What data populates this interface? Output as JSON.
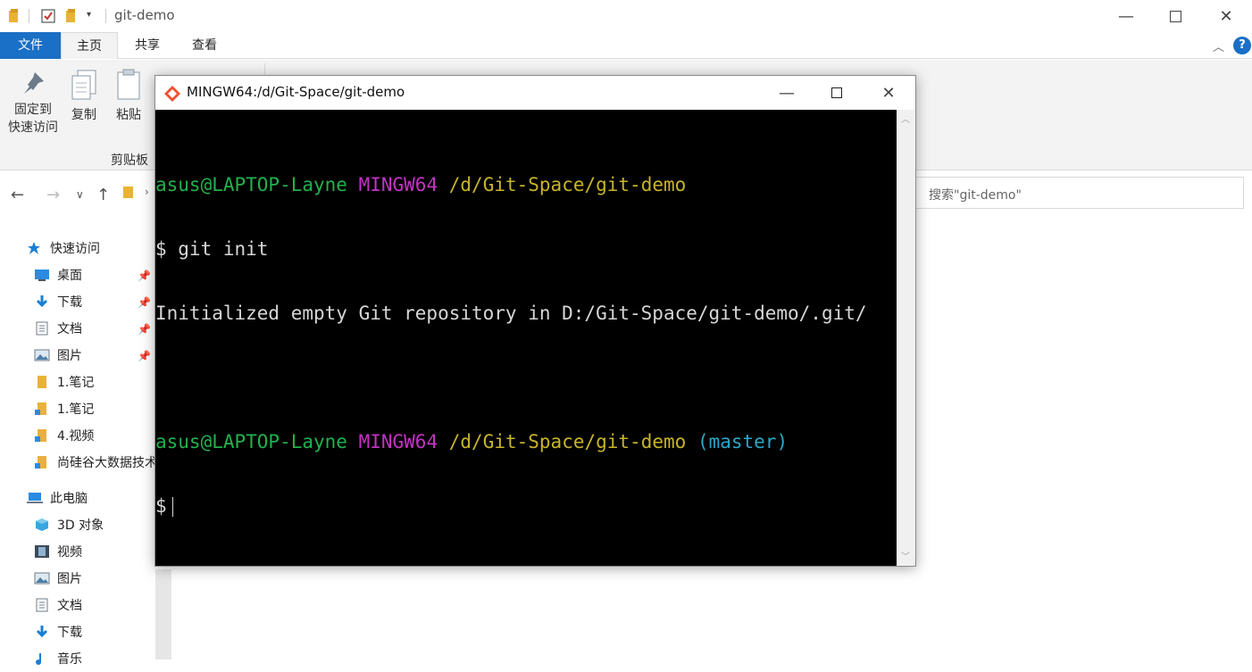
{
  "explorer": {
    "window_title": "git-demo",
    "tabs": [
      {
        "label": "文件"
      },
      {
        "label": "主页"
      },
      {
        "label": "共享"
      },
      {
        "label": "查看"
      }
    ],
    "ribbon": {
      "pin_label_line1": "固定到",
      "pin_label_line2": "快速访问",
      "copy_label": "复制",
      "paste_label": "粘贴",
      "clipboard_group": "剪贴板"
    },
    "search_placeholder": "搜索\"git-demo\"",
    "nav": {
      "quick_access": "快速访问",
      "quick_items": [
        {
          "label": "桌面",
          "pinned": true
        },
        {
          "label": "下载",
          "pinned": true
        },
        {
          "label": "文档",
          "pinned": true
        },
        {
          "label": "图片",
          "pinned": true
        },
        {
          "label": "1.笔记",
          "pinned": false
        },
        {
          "label": "1.笔记",
          "pinned": false
        },
        {
          "label": "4.视频",
          "pinned": false
        },
        {
          "label": "尚硅谷大数据技术",
          "pinned": false
        }
      ],
      "this_pc": "此电脑",
      "pc_items": [
        {
          "label": "3D 对象"
        },
        {
          "label": "视频"
        },
        {
          "label": "图片"
        },
        {
          "label": "文档"
        },
        {
          "label": "下载"
        },
        {
          "label": "音乐"
        }
      ]
    }
  },
  "terminal": {
    "title": "MINGW64:/d/Git-Space/git-demo",
    "lines": [
      {
        "user": "asus@LAPTOP-Layne",
        "env": "MINGW64",
        "path": "/d/Git-Space/git-demo",
        "branch": ""
      },
      {
        "cmd": "$ git init"
      },
      {
        "output": "Initialized empty Git repository in D:/Git-Space/git-demo/.git/"
      },
      {
        "blank": ""
      },
      {
        "user": "asus@LAPTOP-Layne",
        "env": "MINGW64",
        "path": "/d/Git-Space/git-demo",
        "branch": "(master)"
      },
      {
        "prompt": "$"
      }
    ]
  },
  "colors": {
    "file_tab": "#1a6fc6",
    "term_user": "#22b14c",
    "term_env": "#c531c5",
    "term_path": "#c7b42a",
    "term_branch": "#2aa7c7"
  }
}
